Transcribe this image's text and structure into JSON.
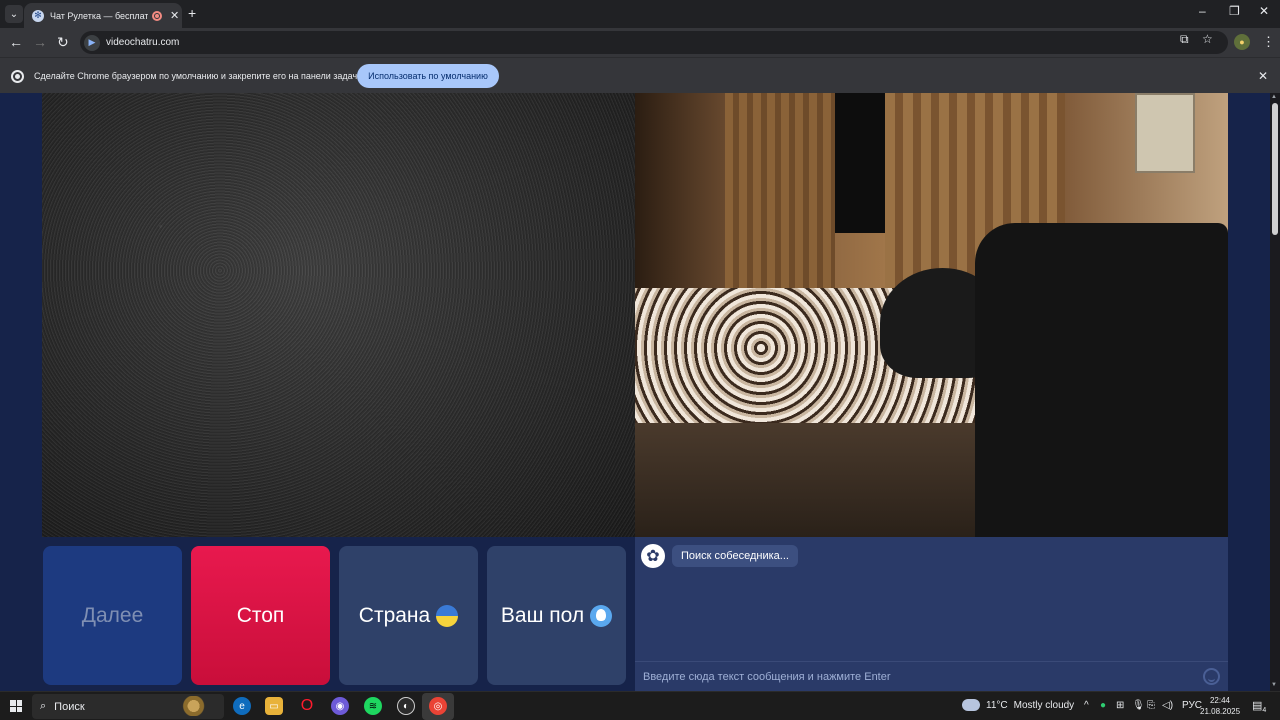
{
  "browser": {
    "tab_title": "Чат Рулетка — бесплатный",
    "url": "videochatru.com",
    "infobar_text": "Сделайте Chrome браузером по умолчанию и закрепите его на панели задач.",
    "infobar_button": "Использовать по умолчанию",
    "icons": [
      "tab-search-icon",
      "favicon",
      "recording-icon",
      "close-icon",
      "new-tab-icon",
      "back-icon",
      "forward-icon",
      "reload-icon",
      "install-icon",
      "star-icon",
      "profile-icon",
      "menu-icon"
    ]
  },
  "page": {
    "buttons": {
      "next": "Далее",
      "stop": "Стоп",
      "country": "Страна",
      "gender": "Ваш пол"
    },
    "chat": {
      "status": "Поиск собеседника...",
      "placeholder": "Введите сюда текст сообщения и нажмите Enter"
    },
    "colors": {
      "background": "#16234a",
      "stop": "#e8194e",
      "next": "#1d3a80",
      "panel": "#2f4169"
    }
  },
  "taskbar": {
    "search_label": "Поиск",
    "weather_temp": "11°C",
    "weather_desc": "Mostly cloudy",
    "lang": "РУС",
    "time": "22:44",
    "date": "21.08.2025",
    "notifications": "4"
  }
}
